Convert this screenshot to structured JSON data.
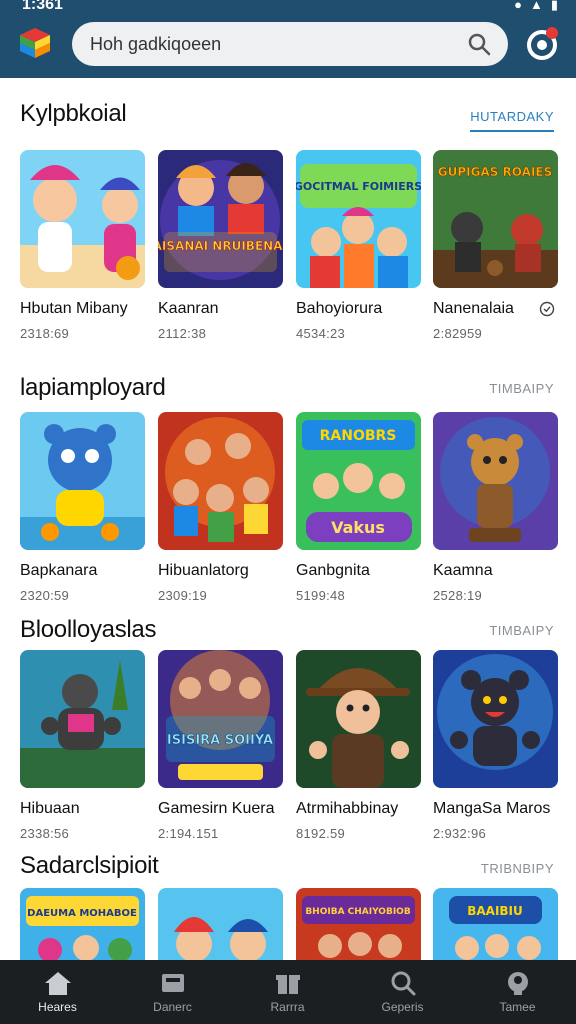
{
  "status": {
    "time": "1:361"
  },
  "search": {
    "text": "Hoh gadkiqoeen"
  },
  "sections": [
    {
      "title": "Kylpbkoial",
      "link": "HUTARDAKY",
      "items": [
        {
          "name": "Hbutan Mibany",
          "meta": "2318:69"
        },
        {
          "name": "Kaanran",
          "meta": "2112:38"
        },
        {
          "name": "Bahoyiorura",
          "meta": "4534:23"
        },
        {
          "name": "Nanenalaia",
          "meta": "2:82959"
        }
      ]
    },
    {
      "title": "lapiamployard",
      "link": "TIMBAIPY",
      "items": [
        {
          "name": "Bapkanara",
          "meta": "2320:59"
        },
        {
          "name": "Hibuanlatorg",
          "meta": "2309:19"
        },
        {
          "name": "Ganbgnita",
          "meta": "5199:48"
        },
        {
          "name": "Kaamna",
          "meta": "2528:19"
        }
      ]
    },
    {
      "title": "Bloolloyaslas",
      "link": "TIMBAIPY",
      "items": [
        {
          "name": "Hibuaan",
          "meta": "2338:56"
        },
        {
          "name": "Gamesirn Kuera",
          "meta": "2:194.151"
        },
        {
          "name": "Atrmihabbinay",
          "meta": "8192.59"
        },
        {
          "name": "MangaSa Maros",
          "meta": "2:932:96"
        }
      ]
    },
    {
      "title": "Sadarclsipioit",
      "link": "TRIBNBIPY",
      "items": [
        {
          "name": "",
          "meta": ""
        },
        {
          "name": "",
          "meta": ""
        },
        {
          "name": "",
          "meta": ""
        },
        {
          "name": "",
          "meta": ""
        }
      ]
    }
  ],
  "thumb_text": [
    [
      "",
      "MAISANAI NRUIBENAES",
      "GOCITMAL FOIMIERS",
      "GUPIGAS ROAIES"
    ],
    [
      "",
      "",
      "RANOBRS",
      ""
    ],
    [
      "",
      "ISISIRA SOIIYA",
      "",
      ""
    ],
    [
      "DAEUMA MOHABOE",
      "",
      "BHOIBA CHAIYOBIOB",
      "BAAIBIU"
    ]
  ],
  "nav": [
    {
      "label": "Heares",
      "icon": "home-icon"
    },
    {
      "label": "Danerc",
      "icon": "library-icon"
    },
    {
      "label": "Rarrra",
      "icon": "gift-icon"
    },
    {
      "label": "Geperis",
      "icon": "search-icon"
    },
    {
      "label": "Tamee",
      "icon": "profile-icon"
    }
  ],
  "colors": {
    "topbar": "#1f4e6e",
    "accent": "#2a7fbf",
    "bottomnav": "#1c1f22"
  }
}
